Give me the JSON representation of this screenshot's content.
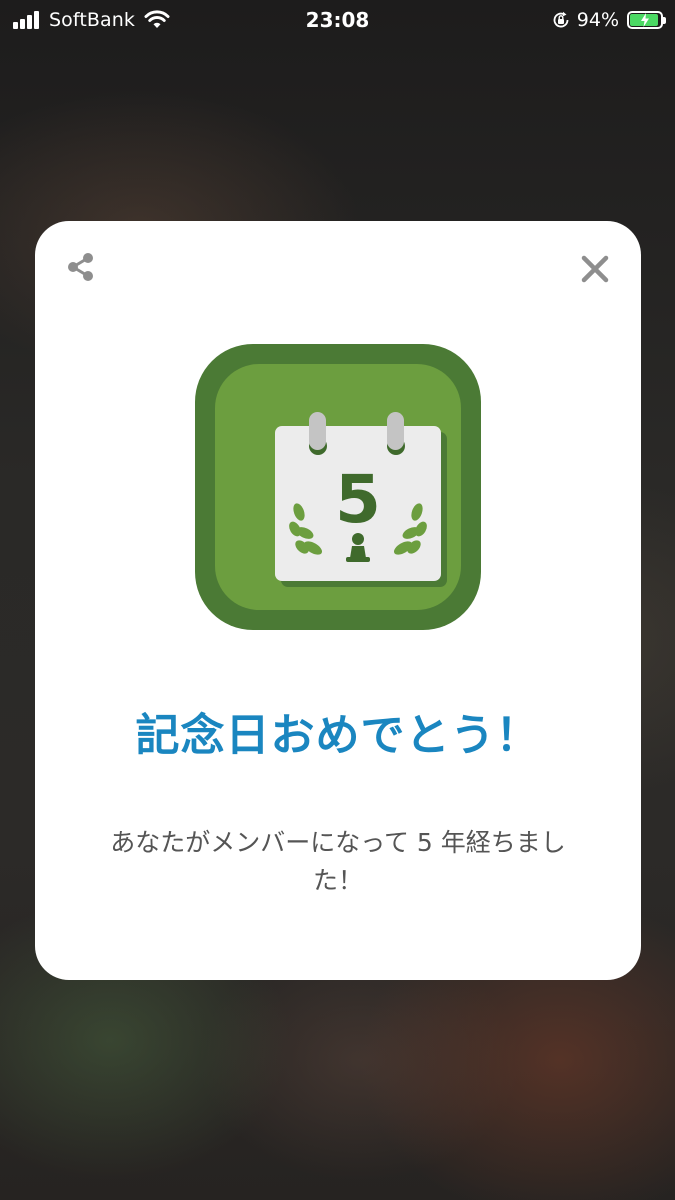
{
  "status_bar": {
    "carrier": "SoftBank",
    "time": "23:08",
    "battery_percent": "94%",
    "battery_level": 0.94,
    "signal_icon": "signal-bars-icon",
    "wifi_icon": "wifi-icon",
    "orientation_lock_icon": "orientation-lock-icon",
    "battery_icon": "battery-charging-icon",
    "battery_color": "#4cd964"
  },
  "dialog": {
    "share_icon": "share-icon",
    "close_icon": "close-icon",
    "badge": {
      "icon": "anniversary-calendar-icon",
      "number": "5",
      "outer_color": "#4b7a35",
      "inner_color": "#6c9e3f"
    },
    "title": "記念日おめでとう！",
    "title_color": "#1a86c0",
    "message": "あなたがメンバーになって 5 年経ちました！"
  }
}
